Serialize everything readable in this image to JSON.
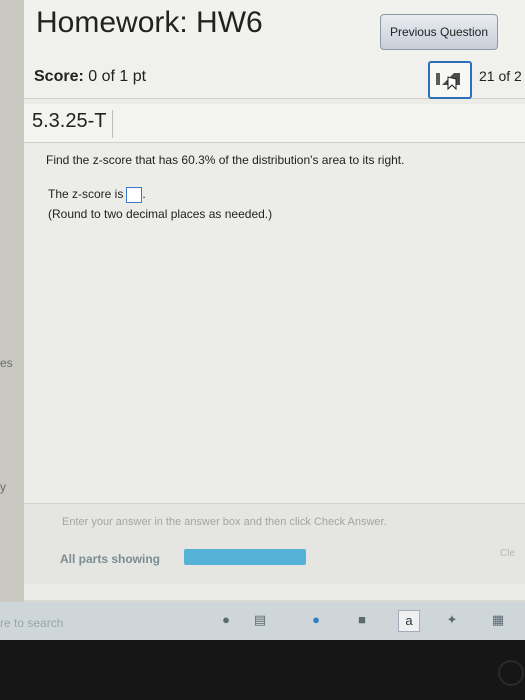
{
  "header": {
    "title": "Homework: HW6",
    "prev_button": "Previous Question"
  },
  "score": {
    "label": "Score:",
    "value": "0 of 1 pt",
    "question_count": "21 of 2"
  },
  "question": {
    "number": "5.3.25-T",
    "prompt": "Find the z-score that has 60.3% of the distribution's area to its right.",
    "answer_prefix": "The z-score is",
    "answer_suffix": ".",
    "answer_value": "",
    "round_note": "(Round to two decimal places as needed.)"
  },
  "footer": {
    "instruction": "Enter your answer in the answer box and then click Check Answer.",
    "parts": "All parts showing",
    "progress": 1.0,
    "clear_fragment": "Cle"
  },
  "left_fragments": [
    "es",
    "y"
  ],
  "taskbar": {
    "search_fragment": "re to search"
  },
  "icons": {
    "nav_icon": "hand-pointer-icon",
    "taskbar": [
      "microphone-icon",
      "task-view-icon",
      "edge-icon",
      "file-explorer-icon",
      "amazon-icon",
      "dropbox-icon",
      "store-icon"
    ]
  },
  "colors": {
    "accent": "#2e6fb8",
    "progress_fill": "#56b2d6"
  }
}
